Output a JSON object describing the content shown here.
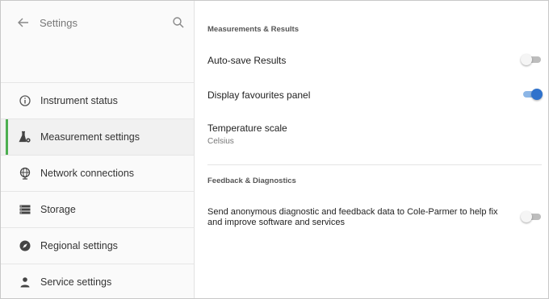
{
  "header": {
    "title": "Settings"
  },
  "nav": {
    "items": [
      {
        "label": "Instrument status",
        "icon": "info-icon",
        "active": false
      },
      {
        "label": "Measurement settings",
        "icon": "flask-gear-icon",
        "active": true
      },
      {
        "label": "Network connections",
        "icon": "globe-icon",
        "active": false
      },
      {
        "label": "Storage",
        "icon": "storage-icon",
        "active": false
      },
      {
        "label": "Regional settings",
        "icon": "compass-icon",
        "active": false
      },
      {
        "label": "Service settings",
        "icon": "person-icon",
        "active": false
      }
    ]
  },
  "measurements": {
    "header": "Measurements & Results",
    "autosave": {
      "label": "Auto-save Results",
      "on": false
    },
    "favourites": {
      "label": "Display favourites panel",
      "on": true
    },
    "temperature": {
      "label": "Temperature scale",
      "value": "Celsius"
    }
  },
  "feedback": {
    "header": "Feedback & Diagnostics",
    "diagnostics": {
      "label": "Send anonymous diagnostic and feedback data to Cole-Parmer to help fix and improve software and services",
      "on": false
    }
  },
  "colors": {
    "accent": "#2f72cc",
    "active_indicator": "#4caf50"
  }
}
